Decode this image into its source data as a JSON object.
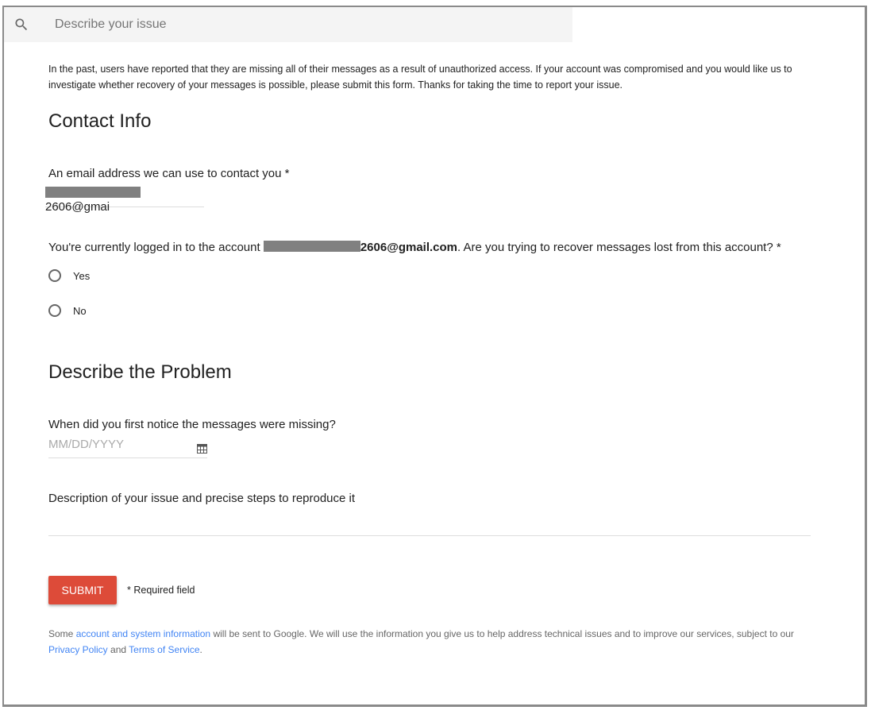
{
  "search": {
    "placeholder": "Describe your issue",
    "icon": "search-icon"
  },
  "intro": "In the past, users have reported that they are missing all of their messages as a result of unauthorized access. If your account was compromised and you would like us to investigate whether recovery of your messages is possible, please submit this form. Thanks for taking the time to report your issue.",
  "contact": {
    "heading": "Contact Info",
    "email_label": "An email address we can use to contact you *",
    "email_value_visible": "2606@gmai",
    "account_prefix": "You're currently logged in to the account ",
    "account_visible": "2606@gmail.com",
    "account_suffix": ". Are you trying to recover messages lost from this account? *",
    "options": [
      "Yes",
      "No"
    ]
  },
  "problem": {
    "heading": "Describe the Problem",
    "date_label": "When did you first notice the messages were missing?",
    "date_placeholder": "MM/DD/YYYY",
    "desc_label": "Description of your issue and precise steps to reproduce it"
  },
  "submit_label": "SUBMIT",
  "required_note": "* Required field",
  "footer": {
    "t1": "Some ",
    "link1": "account and system information",
    "t2": " will be sent to Google. We will use the information you give us to help address technical issues and to improve our services, subject to our ",
    "link2": "Privacy Policy",
    "t3": " and ",
    "link3": "Terms of Service",
    "t4": "."
  },
  "colors": {
    "accent": "#dd4b39",
    "link": "#4285f4"
  }
}
